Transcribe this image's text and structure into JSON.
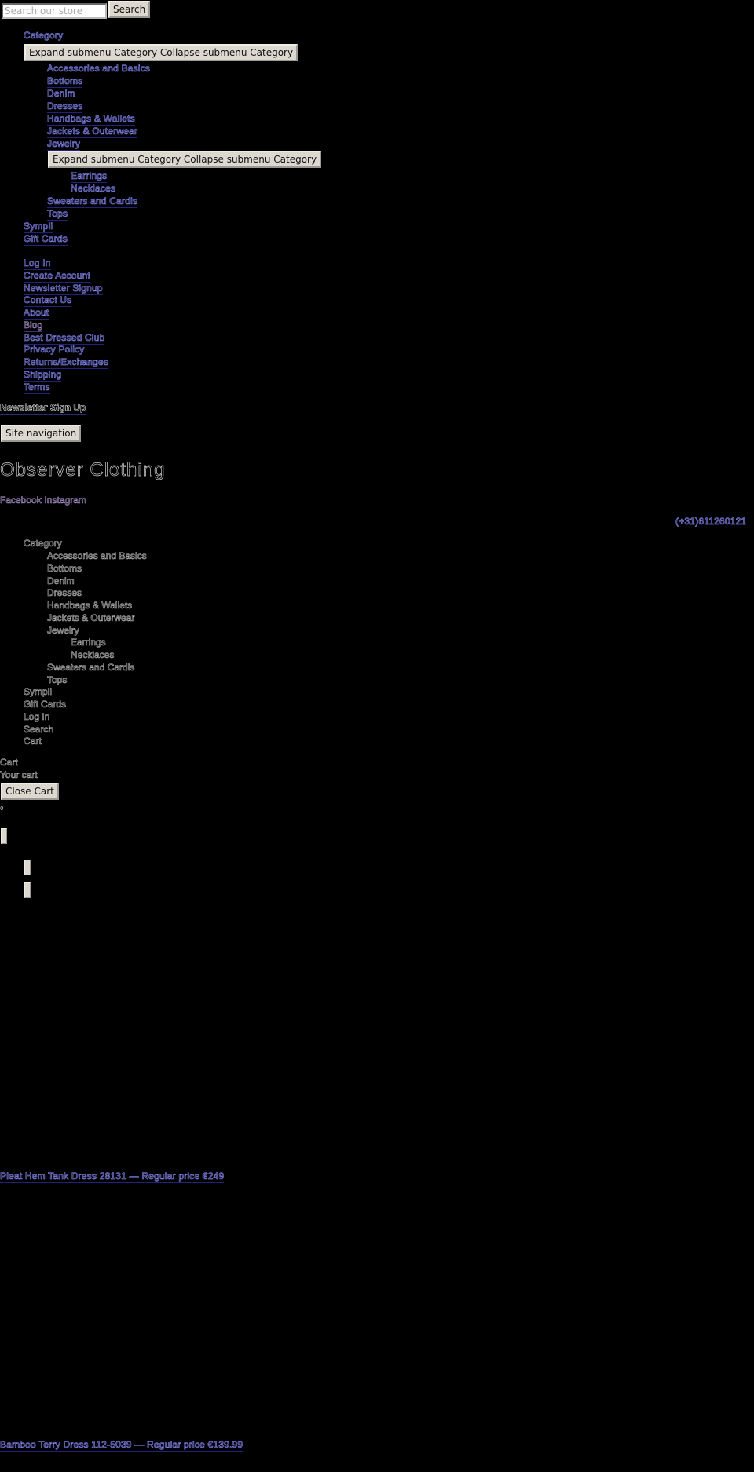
{
  "search": {
    "placeholder": "Search our store",
    "button_label": "Search"
  },
  "mobile_nav": {
    "category_label": "Category",
    "expand_collapse_label": "Expand submenu Category Collapse submenu Category",
    "subcategories": [
      "Accessories and Basics",
      "Bottoms",
      "Denim",
      "Dresses",
      "Handbags & Wallets",
      "Jackets & Outerwear",
      "Jewelry"
    ],
    "jewelry_expand_collapse_label": "Expand submenu Category Collapse submenu Category",
    "jewelry_items": [
      "Earrings",
      "Necklaces"
    ],
    "subcategories_after": [
      "Sweaters and Cardis",
      "Tops"
    ],
    "top_items": [
      "Sympli",
      "Gift Cards"
    ],
    "account_links": [
      "Log In",
      "Create Account",
      "Newsletter Signup",
      "Contact Us",
      "About",
      "Blog",
      "Best Dressed Club",
      "Privacy Policy",
      "Returns/Exchanges",
      "Shipping",
      "Terms"
    ]
  },
  "newsletter": {
    "label": "Newsletter Sign Up"
  },
  "site_nav_button": "Site navigation",
  "site_title": "Observer Clothing",
  "social": {
    "facebook": "Facebook",
    "instagram": "Instagram"
  },
  "phone": "(+31)611260121",
  "desktop_nav": {
    "category_label": "Category",
    "subcategories": [
      "Accessories and Basics",
      "Bottoms",
      "Denim",
      "Dresses",
      "Handbags & Wallets",
      "Jackets & Outerwear",
      "Jewelry"
    ],
    "jewelry_items": [
      "Earrings",
      "Necklaces"
    ],
    "subcategories_after": [
      "Sweaters and Cardis",
      "Tops"
    ],
    "top_items": [
      "Sympli",
      "Gift Cards",
      "Log In",
      "Search",
      "Cart"
    ]
  },
  "cart": {
    "title": "Cart",
    "subtitle": "Your cart",
    "close_label": "Close Cart",
    "count": "0"
  },
  "products": [
    {
      "name": "Pleat Hem Tank Dress 28131",
      "separator": "—",
      "price_label": "Regular price",
      "price": "€249"
    },
    {
      "name": "Bamboo Terry Dress 112-5039",
      "separator": "—",
      "price_label": "Regular price",
      "price": "€139.99"
    }
  ],
  "colors": {
    "background": "#000000",
    "link": "#8a8cf0",
    "visited_link": "#b49ad8",
    "button_bg": "#dcd8d0"
  }
}
